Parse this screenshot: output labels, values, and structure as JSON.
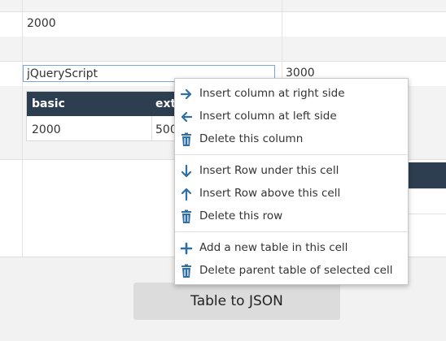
{
  "outer_table": {
    "row1_col1": "2000",
    "edit_value": "jQueryScript",
    "row3_col2": "3000"
  },
  "inner_table": {
    "headers": [
      "basic",
      "extr"
    ],
    "cells": [
      "2000",
      "500"
    ]
  },
  "context_menu": {
    "items": [
      {
        "label": "Insert column at right side",
        "icon": "arrow-right-icon"
      },
      {
        "label": "Insert column at left side",
        "icon": "arrow-left-icon"
      },
      {
        "label": "Delete this column",
        "icon": "trash-icon"
      },
      {
        "label": "Insert Row under this cell",
        "icon": "arrow-down-icon"
      },
      {
        "label": "Insert Row above this cell",
        "icon": "arrow-up-icon"
      },
      {
        "label": "Delete this row",
        "icon": "trash-icon"
      },
      {
        "label": "Add a new table in this cell",
        "icon": "plus-icon"
      },
      {
        "label": "Delete parent table of selected cell",
        "icon": "trash-icon"
      }
    ]
  },
  "buttons": {
    "table_to_json": "Table to JSON"
  },
  "colors": {
    "icon": "#2f6fa3",
    "header_bg": "#2c3e50"
  }
}
